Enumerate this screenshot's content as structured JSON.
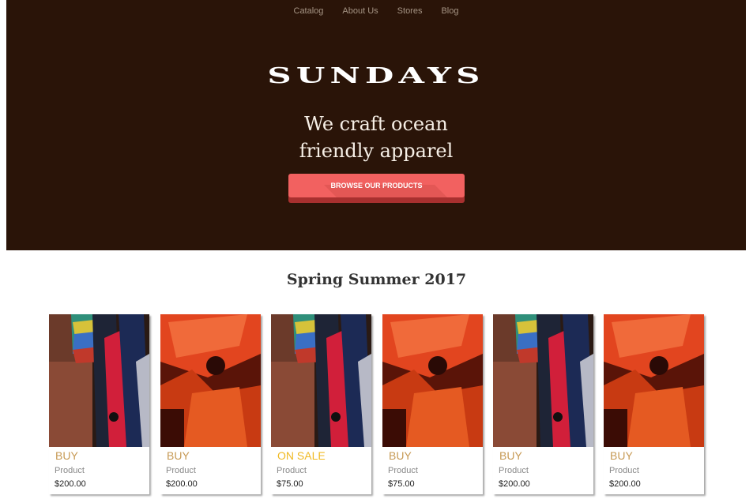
{
  "nav": {
    "items": [
      {
        "label": "Catalog"
      },
      {
        "label": "About Us"
      },
      {
        "label": "Stores"
      },
      {
        "label": "Blog"
      }
    ]
  },
  "hero": {
    "brand": "SUNDAYS",
    "tagline_line1": "We craft ocean",
    "tagline_line2": "friendly apparel",
    "cta_label": "BROWSE OUR PRODUCTS",
    "background_color": "#2a1408",
    "cta_color": "#f26160"
  },
  "collection": {
    "title": "Spring Summer 2017",
    "products": [
      {
        "image": "colorful-fabric-photo",
        "action": "BUY",
        "name": "Product",
        "price": "$200.00"
      },
      {
        "image": "red-lit-man-photo",
        "action": "BUY",
        "name": "Product",
        "price": "$200.00"
      },
      {
        "image": "colorful-fabric-photo",
        "action": "ON SALE",
        "name": "Product",
        "price": "$75.00"
      },
      {
        "image": "red-lit-man-photo",
        "action": "BUY",
        "name": "Product",
        "price": "$75.00"
      },
      {
        "image": "colorful-fabric-photo",
        "action": "BUY",
        "name": "Product",
        "price": "$200.00"
      },
      {
        "image": "red-lit-man-photo",
        "action": "BUY",
        "name": "Product",
        "price": "$200.00"
      }
    ]
  }
}
